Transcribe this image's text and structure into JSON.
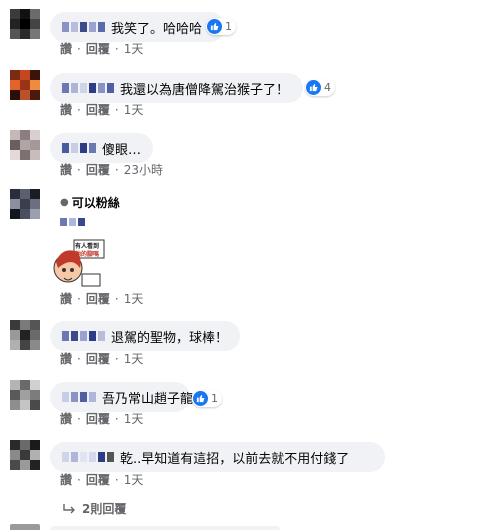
{
  "comments": [
    {
      "text": "我笑了。哈哈哈",
      "likes": "1",
      "actions": {
        "read": "讚",
        "reply": "回覆",
        "time": "1天"
      }
    },
    {
      "text": "我還以為唐僧降駕治猴子了！",
      "likes": "4",
      "actions": {
        "read": "讚",
        "reply": "回覆",
        "time": "1天"
      }
    },
    {
      "text": "傻眼…",
      "actions": {
        "read": "讚",
        "reply": "回覆",
        "time": "23小時"
      }
    },
    {
      "name_visible": "可以粉絲",
      "sticker_text_1": "有人看到",
      "sticker_text_2": "他的腳嗎",
      "actions": {
        "read": "讚",
        "reply": "回覆",
        "time": "1天"
      }
    },
    {
      "text": "退駕的聖物，球棒！",
      "actions": {
        "read": "讚",
        "reply": "回覆",
        "time": "1天"
      }
    },
    {
      "text": "吾乃常山趙子龍",
      "likes": "1",
      "actions": {
        "read": "讚",
        "reply": "回覆",
        "time": "1天"
      }
    },
    {
      "text": "乾..早知道有這招，以前去就不用付錢了",
      "actions": {
        "read": "讚",
        "reply": "回覆",
        "time": "1天"
      }
    }
  ],
  "replies_link": "2則回覆",
  "colors": {
    "bubble": "#f0f2f5",
    "like": "#1877f2",
    "meta": "#65676b"
  }
}
